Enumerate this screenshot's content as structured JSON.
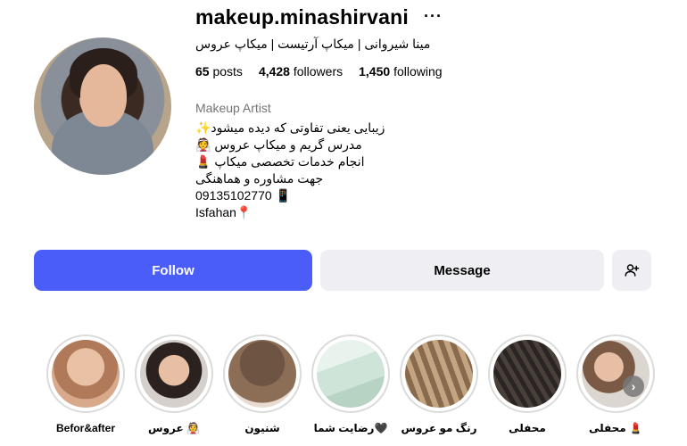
{
  "profile": {
    "username": "makeup.minashirvani",
    "more_icon": "more-horizontal-icon",
    "fullname": "مینا شیروانی | میکاپ آرتیست | میکاپ عروس",
    "stats": {
      "posts_count": "65",
      "posts_label": "posts",
      "followers_count": "4,428",
      "followers_label": "followers",
      "following_count": "1,450",
      "following_label": "following"
    },
    "category": "Makeup Artist",
    "bio_lines": [
      "زیبایی یعنی تفاوتی که دیده میشود✨",
      "مدرس گریم و میکاپ عروس 👰",
      "انجام خدمات تخصصی میکاپ 💄",
      "جهت مشاوره و هماهنگی",
      "09135102770 📱",
      "Isfahan📍"
    ]
  },
  "actions": {
    "follow_label": "Follow",
    "message_label": "Message",
    "add_user_icon": "add-user-icon"
  },
  "highlights": [
    {
      "label": "Befor&after",
      "color": "#d9a98c"
    },
    {
      "label": "عروس 👰",
      "color": "#b9a89c"
    },
    {
      "label": "شنیون",
      "color": "#8c6e57"
    },
    {
      "label": "رضایت شما🖤",
      "color": "#cfe4d8"
    },
    {
      "label": "رنگ مو عروس",
      "color": "#a88a6a"
    },
    {
      "label": "محفلی",
      "color": "#2e2a28"
    },
    {
      "label": "محفلی 💄",
      "color": "#c8a07e"
    }
  ],
  "colors": {
    "follow_bg": "#4a5df9",
    "secondary_bg": "#efeff3"
  }
}
